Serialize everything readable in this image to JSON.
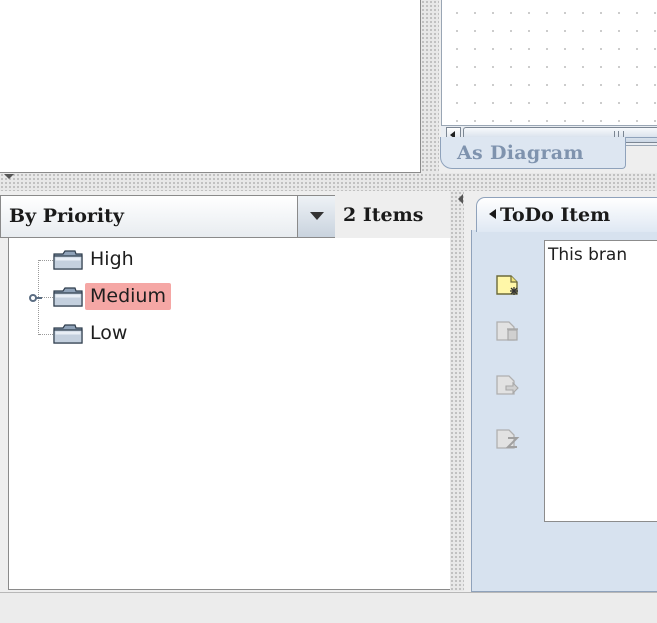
{
  "diagram": {
    "tab_label": "As Diagram"
  },
  "todo_pane": {
    "perspective": "By Priority",
    "item_count": "2 Items",
    "tree": [
      {
        "label": "High",
        "selected": false
      },
      {
        "label": "Medium",
        "selected": true
      },
      {
        "label": "Low",
        "selected": false
      }
    ],
    "selection_color": "#f5a7a5"
  },
  "details_pane": {
    "tab_label": "ToDo Item",
    "description_text": "This bran",
    "tool_icons": [
      "new-todo-icon",
      "resolve-todo-icon",
      "forward-todo-icon",
      "snooze-todo-icon"
    ]
  },
  "colors": {
    "accent_panel": "#d7e2ef",
    "tab_border": "#8fa2bb"
  }
}
